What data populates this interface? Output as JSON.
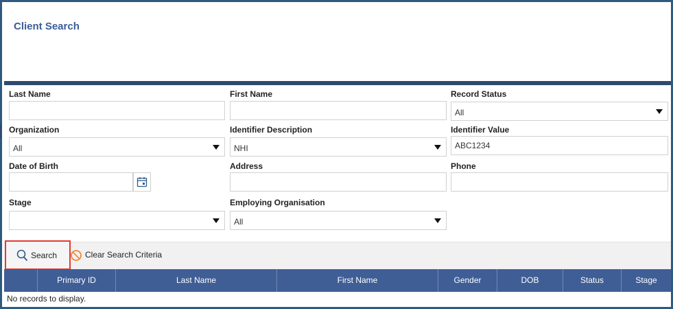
{
  "page": {
    "title": "Client Search"
  },
  "form": {
    "last_name": {
      "label": "Last Name",
      "value": ""
    },
    "first_name": {
      "label": "First Name",
      "value": ""
    },
    "record_status": {
      "label": "Record Status",
      "value": "All"
    },
    "organization": {
      "label": "Organization",
      "value": "All"
    },
    "identifier_description": {
      "label": "Identifier Description",
      "value": "NHI"
    },
    "identifier_value": {
      "label": "Identifier Value",
      "value": "ABC1234"
    },
    "date_of_birth": {
      "label": "Date of Birth",
      "value": ""
    },
    "address": {
      "label": "Address",
      "value": ""
    },
    "phone": {
      "label": "Phone",
      "value": ""
    },
    "stage": {
      "label": "Stage",
      "value": ""
    },
    "employing_organisation": {
      "label": "Employing Organisation",
      "value": "All"
    }
  },
  "toolbar": {
    "search_label": "Search",
    "clear_label": "Clear Search Criteria",
    "highlight_color": "#e23a34"
  },
  "grid": {
    "columns": [
      "Primary ID",
      "Last Name",
      "First Name",
      "Gender",
      "DOB",
      "Status",
      "Stage"
    ],
    "empty_message": "No records to display.",
    "header_color": "#3f5e96"
  }
}
